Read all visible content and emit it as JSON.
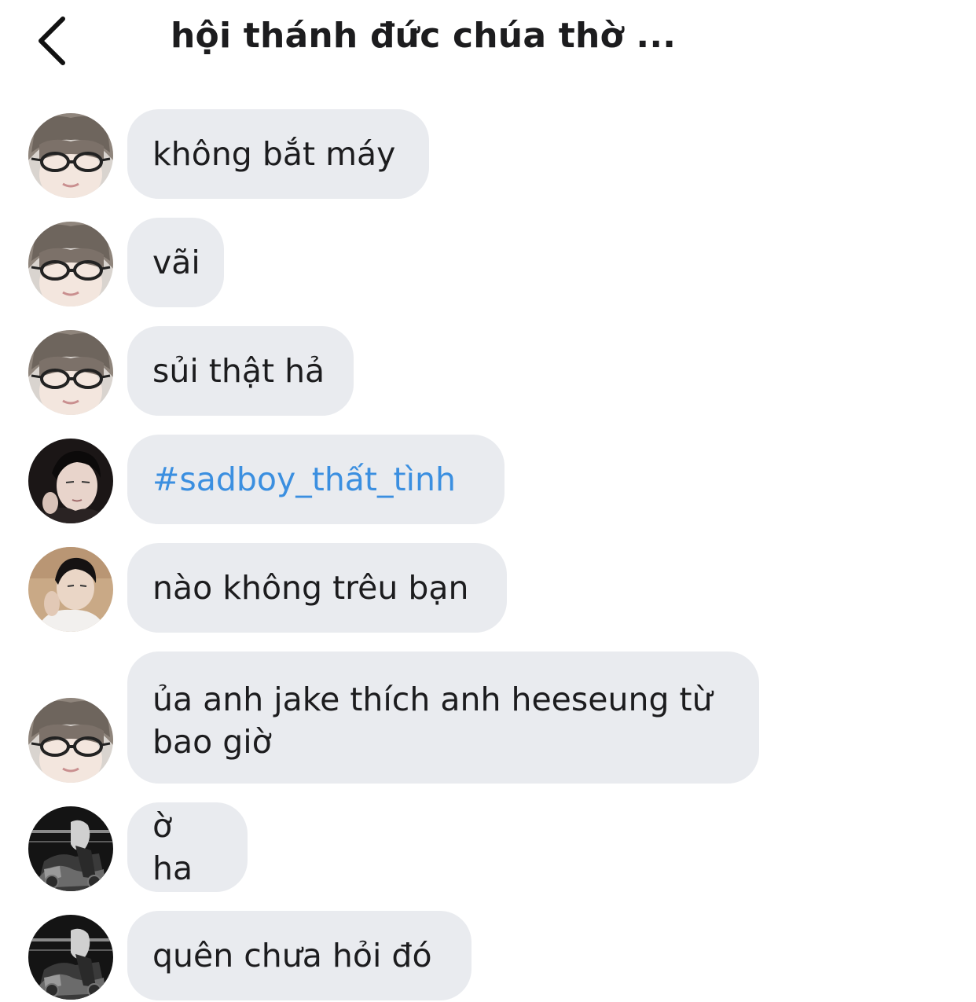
{
  "header": {
    "title": "hội thánh đức chúa thờ ..."
  },
  "messages": [
    {
      "avatar": "glasses-girl",
      "text": "không bắt máy"
    },
    {
      "avatar": "glasses-girl",
      "text": "vãi"
    },
    {
      "avatar": "glasses-girl",
      "text": "sủi thật hả"
    },
    {
      "avatar": "dark-portrait",
      "text": "#sadboy_thất_tình",
      "hashtag": true
    },
    {
      "avatar": "beach-portrait",
      "text": "nào không trêu bạn"
    },
    {
      "avatar": "glasses-girl",
      "text": "ủa anh jake thích anh heeseung từ bao giờ"
    },
    {
      "avatar": "bw-photo",
      "text": "ờ ha"
    },
    {
      "avatar": "bw-photo",
      "text": "quên chưa hỏi đó"
    }
  ],
  "colors": {
    "bubble": "#e9ebef",
    "text": "#1c1c1e",
    "hashtag": "#3b8fe0",
    "background": "#ffffff"
  }
}
